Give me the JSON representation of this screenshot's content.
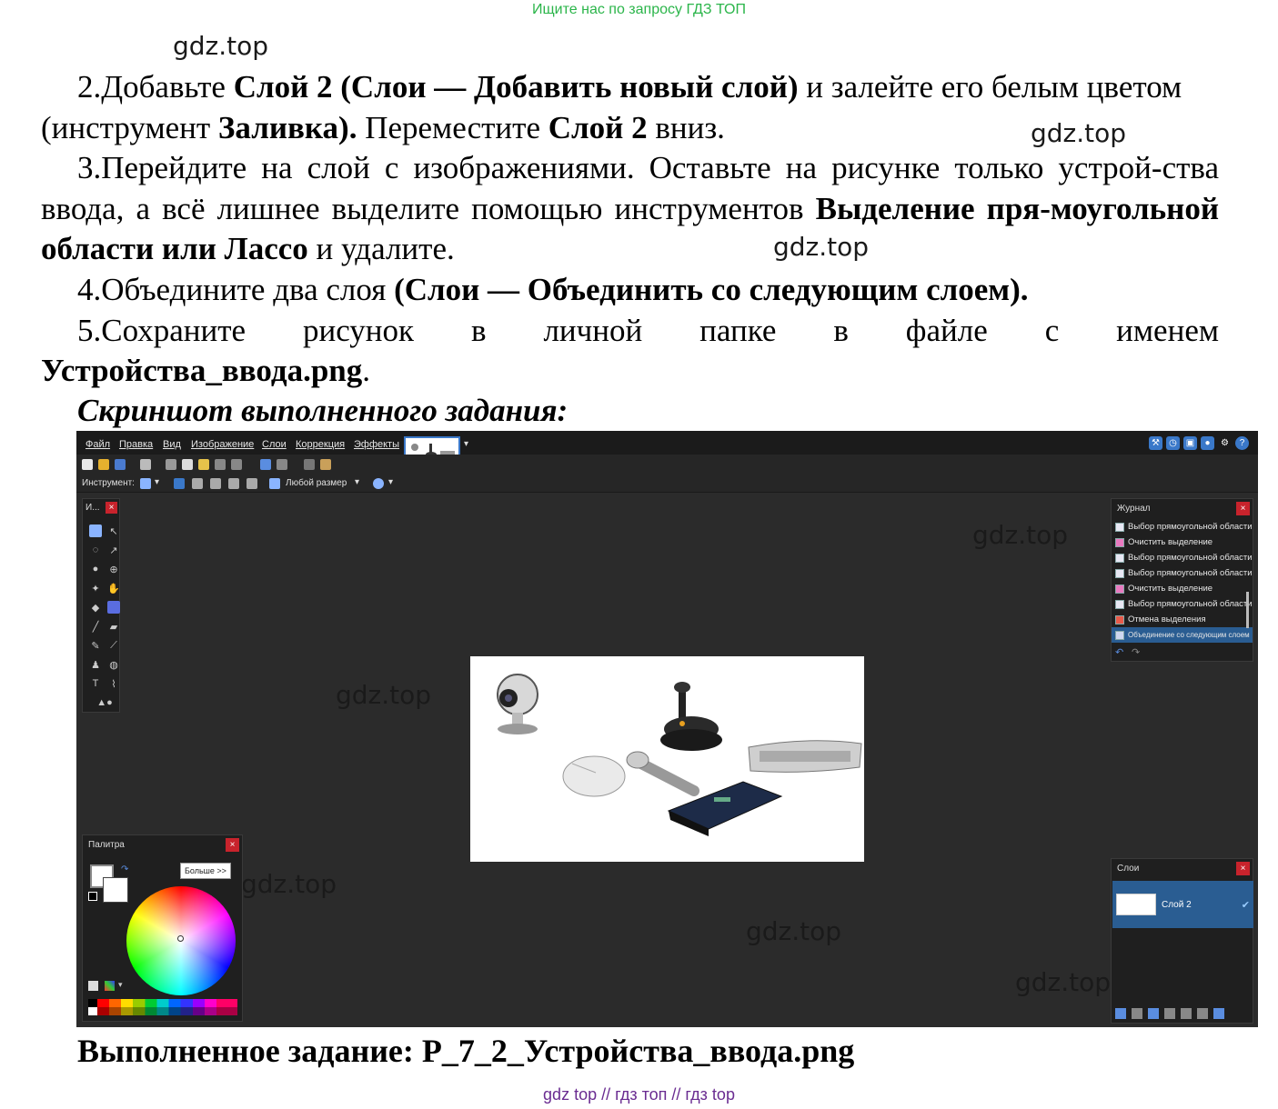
{
  "banner": "Ищите нас по запросу ГДЗ ТОП",
  "watermark": "gdz.top",
  "paragraphs": {
    "p2_a": "2.Добавьте ",
    "p2_b": "Слой 2 (Слои — Добавить новый слой)",
    "p2_c": " и залейте его белым цветом (инструмент ",
    "p2_d": "Заливка).",
    "p2_e": " Переместите ",
    "p2_f": "Слой 2",
    "p2_g": " вниз.",
    "p3_a": "3.Перейдите на слой с изображениями. Оставьте на рисунке только устрой-ства ввода, а всё лишнее выделите помощью инструментов ",
    "p3_b": "Выделение пря-моугольной области или Лассо",
    "p3_c": " и удалите.",
    "p4_a": "4.Объедините два слоя ",
    "p4_b": "(Слои — Объединить со следующим слоем).",
    "p5_a": "5.Сохраните рисунок в личной папке в файле с именем",
    "p5_b": "Устройства_ввода.png",
    "p5_c": "."
  },
  "caption": "Скриншот выполненного задания:",
  "result": "Выполненное задание: Р_7_2_Устройства_ввода.png",
  "bottom_links": "gdz top  //  гдз топ  //  гдз top",
  "app": {
    "menu": [
      "Файл",
      "Правка",
      "Вид",
      "Изображение",
      "Слои",
      "Коррекция",
      "Эффекты"
    ],
    "toolbar_label": "Инструмент:",
    "size_label": "Любой размер",
    "tools_title": "И...",
    "history": {
      "title": "Журнал",
      "items": [
        "Выбор прямоугольной области",
        "Очистить выделение",
        "Выбор прямоугольной области",
        "Выбор прямоугольной области",
        "Очистить выделение",
        "Выбор прямоугольной области",
        "Отмена выделения",
        "Объединение со следующим слоем"
      ]
    },
    "palette": {
      "title": "Палитра",
      "more_button": "Больше >>"
    },
    "layers": {
      "title": "Слои",
      "layer_name": "Слой 2"
    },
    "accent": "#2a5d92",
    "close_color": "#c8232c"
  }
}
